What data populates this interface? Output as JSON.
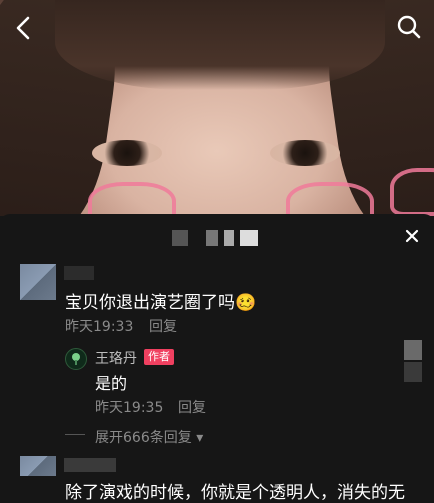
{
  "comment": {
    "text": "宝贝你退出演艺圈了吗🥴",
    "time": "昨天19:33",
    "reply_label": "回复"
  },
  "reply": {
    "author": "王珞丹",
    "badge": "作者",
    "text": "是的",
    "time": "昨天19:35",
    "reply_label": "回复"
  },
  "expand": {
    "label": "展开666条回复",
    "arrow": "▾"
  },
  "partial_comment": {
    "text": "除了演戏的时候，你就是个透明人，消失的无"
  },
  "icons": {
    "back": "chevron-left-icon",
    "search": "search-icon",
    "close": "close-icon"
  },
  "colors": {
    "panel_bg": "#161616",
    "badge_bg": "#f04060",
    "meta_text": "#8a8a8a"
  }
}
